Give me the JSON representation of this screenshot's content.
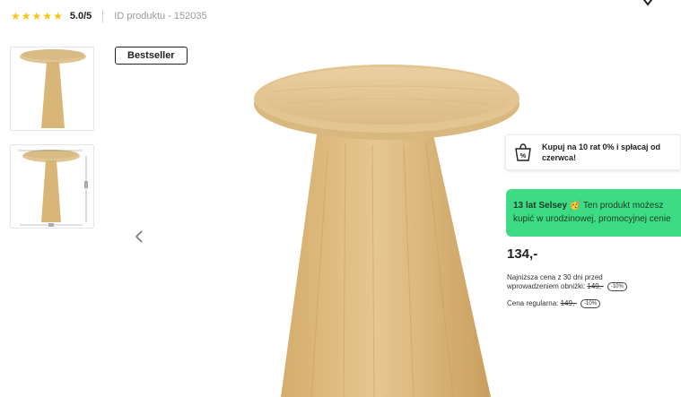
{
  "rating": {
    "stars": 5,
    "score": "5.0/5",
    "star_color": "#f5c518"
  },
  "product": {
    "id_label": "ID produktu - 152035"
  },
  "gallery": {
    "badge": "Bestseller",
    "thumbnails": [
      "thumbnail-1",
      "thumbnail-2"
    ]
  },
  "installments": {
    "icon": "installment-percent-bag-icon",
    "text_line1": "Kupuj na 10 rat 0% i spłacaj od",
    "text_line2": "czerwca!"
  },
  "promo": {
    "bold": "13 lat Selsey",
    "emoji": "🥳",
    "line1_rest": " Ten produkt możesz",
    "line2": "kupić w urodzinowej, promocyjnej cenie",
    "bg_color": "#3ddc84"
  },
  "pricing": {
    "price": "134,-",
    "lowest_line1": "Najniższa cena z 30 dni przed",
    "lowest_line2_prefix": "wprowadzeniem obniżki: ",
    "lowest_value": "149,-",
    "lowest_discount": "-10%",
    "regular_prefix": "Cena regularna: ",
    "regular_value": "149,-",
    "regular_discount": "-10%"
  }
}
